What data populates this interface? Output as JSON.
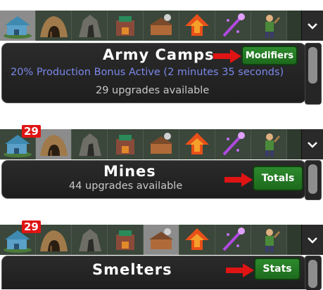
{
  "section1": {
    "title": "Army Camps",
    "bonus": "20% Production Bonus Active (2 minutes 35 seconds)",
    "upgrades": "29 upgrades available",
    "button": "Modifiers"
  },
  "section2": {
    "badge": "29",
    "title": "Mines",
    "upgrades": "44 upgrades available",
    "button": "Totals"
  },
  "section3": {
    "badge": "29",
    "title": "Smelters",
    "button": "Stats"
  },
  "icons": [
    "house-icon",
    "mine-icon",
    "rock-icon",
    "smelter-icon",
    "workshop-icon",
    "upgrade-arrow-icon",
    "magic-wand-icon",
    "worker-icon"
  ],
  "colors": {
    "button_green": "#2d8a2d",
    "bonus_text": "#7b88ea",
    "arrow_red": "#e01414",
    "badge_red": "#e01414"
  }
}
